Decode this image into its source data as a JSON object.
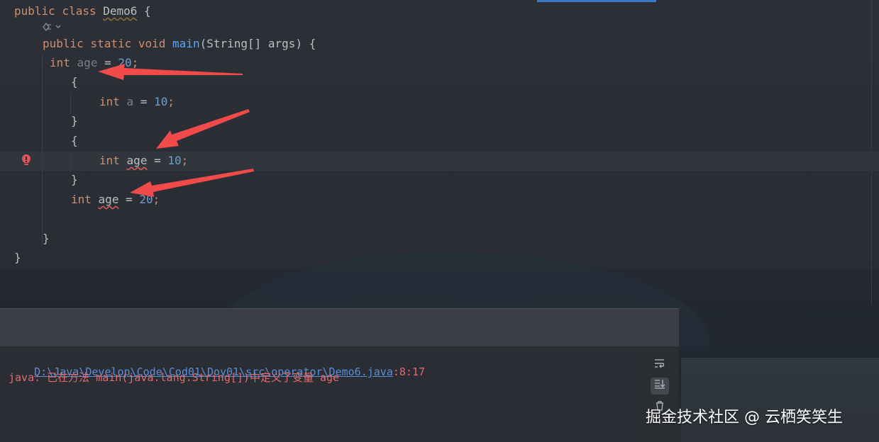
{
  "editor": {
    "lines": [
      {
        "tokens": [
          [
            "kw",
            "public"
          ],
          [
            "punct",
            " "
          ],
          [
            "kw",
            "class"
          ],
          [
            "punct",
            " "
          ],
          [
            "classname",
            "Demo6"
          ],
          [
            "punct",
            " {"
          ]
        ]
      },
      {
        "tokens": [
          [
            "kw",
            "public"
          ],
          [
            "punct",
            " "
          ],
          [
            "kw",
            "static"
          ],
          [
            "punct",
            " "
          ],
          [
            "kw",
            "void"
          ],
          [
            "punct",
            " "
          ],
          [
            "fn",
            "main"
          ],
          [
            "punct",
            "(String[] args) {"
          ]
        ]
      },
      {
        "tokens": [
          [
            "kw",
            "int"
          ],
          [
            "punct",
            " "
          ],
          [
            "var",
            "age"
          ],
          [
            "punct",
            " = "
          ],
          [
            "num",
            "20"
          ],
          [
            "semi",
            ";"
          ]
        ]
      },
      {
        "tokens": [
          [
            "punct",
            "{"
          ]
        ]
      },
      {
        "tokens": [
          [
            "kw",
            "int"
          ],
          [
            "punct",
            " "
          ],
          [
            "var",
            "a"
          ],
          [
            "punct",
            " = "
          ],
          [
            "num",
            "10"
          ],
          [
            "semi",
            ";"
          ]
        ]
      },
      {
        "tokens": [
          [
            "punct",
            "}"
          ]
        ]
      },
      {
        "tokens": [
          [
            "punct",
            "{"
          ]
        ]
      },
      {
        "tokens": [
          [
            "kw",
            "int"
          ],
          [
            "punct",
            " "
          ],
          [
            "err",
            "age"
          ],
          [
            "punct",
            " = "
          ],
          [
            "num",
            "10"
          ],
          [
            "semi",
            ";"
          ]
        ]
      },
      {
        "tokens": [
          [
            "punct",
            "}"
          ]
        ]
      },
      {
        "tokens": [
          [
            "kw",
            "int"
          ],
          [
            "punct",
            " "
          ],
          [
            "err",
            "age"
          ],
          [
            "punct",
            " = "
          ],
          [
            "num",
            "20"
          ],
          [
            "semi",
            ";"
          ]
        ]
      },
      {
        "tokens": [
          [
            "punct",
            "}"
          ]
        ]
      },
      {
        "tokens": [
          [
            "punct",
            "}"
          ]
        ]
      }
    ],
    "plugin_icon": "plugin-icon",
    "error_icon": "error-gutter-icon"
  },
  "console": {
    "path_link": "D:\\Java\\Develop\\Code\\Cod01\\Doy01\\src\\operator\\Demo6.java",
    "path_pos": ":8:17",
    "message": "java: 已在方法 main(java.lang.String[])中定义了变量 age",
    "tools": [
      "soft-wrap-icon",
      "scroll-to-end-icon",
      "trash-icon"
    ]
  },
  "watermark": "掘金技术社区 @ 云栖笑笑生",
  "colors": {
    "keyword": "#cf8e6d",
    "number": "#6c9fd1",
    "variable": "#7a7e85",
    "method": "#56a8f5",
    "error_text": "#e06c6c",
    "link": "#5a8ed6",
    "arrow": "#f04a4a"
  }
}
